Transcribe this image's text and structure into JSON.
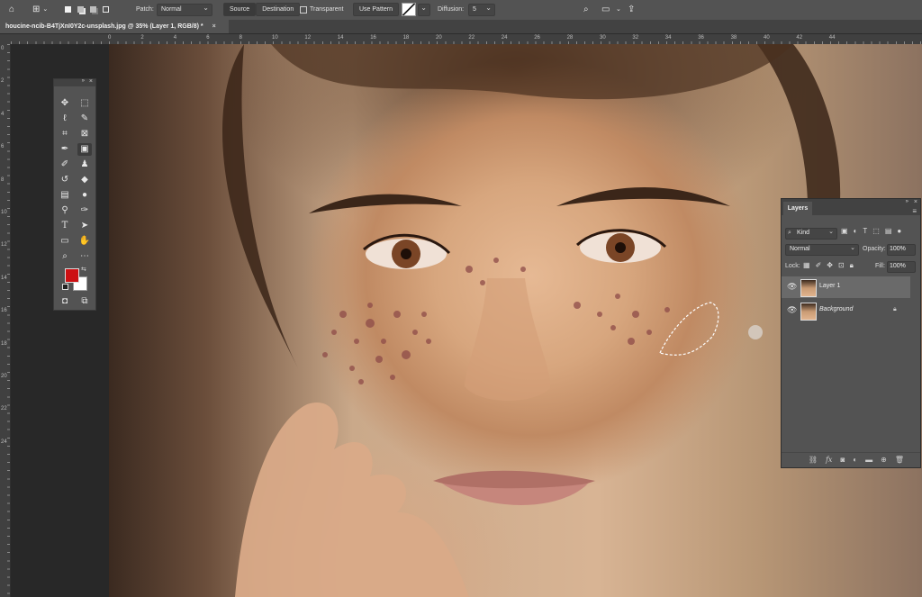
{
  "options_bar": {
    "patch_label": "Patch:",
    "patch_mode": "Normal",
    "source_button": "Source",
    "destination_button": "Destination",
    "transparent_label": "Transparent",
    "use_pattern_button": "Use Pattern",
    "diffusion_label": "Diffusion:",
    "diffusion_value": "5"
  },
  "document_tab": {
    "title": "houcine-ncib-B4TjXnI0Y2c-unsplash.jpg @ 35% (Layer 1, RGB/8) *",
    "close": "×"
  },
  "ruler": {
    "h_numbers": [
      "0",
      "2",
      "4",
      "6",
      "8",
      "10",
      "12",
      "14",
      "16",
      "18",
      "20",
      "22",
      "24",
      "26",
      "28",
      "30",
      "32",
      "34",
      "36",
      "38",
      "40",
      "42",
      "44"
    ],
    "v_numbers": [
      "0",
      "2",
      "4",
      "6",
      "8",
      "10",
      "12",
      "14",
      "16",
      "18",
      "20",
      "22",
      "24"
    ]
  },
  "tools": [
    "move-tool",
    "marquee-tool",
    "lasso-tool",
    "quick-select-tool",
    "crop-tool",
    "frame-tool",
    "eyedropper-tool",
    "patch-tool",
    "brush-tool",
    "clone-stamp-tool",
    "history-brush-tool",
    "eraser-tool",
    "gradient-tool",
    "blur-tool",
    "dodge-tool",
    "pen-tool",
    "type-tool",
    "path-select-tool",
    "rectangle-tool",
    "hand-tool",
    "zoom-tool",
    "more-tools"
  ],
  "colors": {
    "foreground": "#cc0f12",
    "background": "#ffffff"
  },
  "layers_panel": {
    "tab_label": "Layers",
    "filter_kind": "Kind",
    "blend_mode": "Normal",
    "opacity_label": "Opacity:",
    "opacity_value": "100%",
    "lock_label": "Lock:",
    "fill_label": "Fill:",
    "fill_value": "100%",
    "layers": [
      {
        "name": "Layer 1",
        "selected": true,
        "locked": false
      },
      {
        "name": "Background",
        "selected": false,
        "locked": true
      }
    ]
  }
}
